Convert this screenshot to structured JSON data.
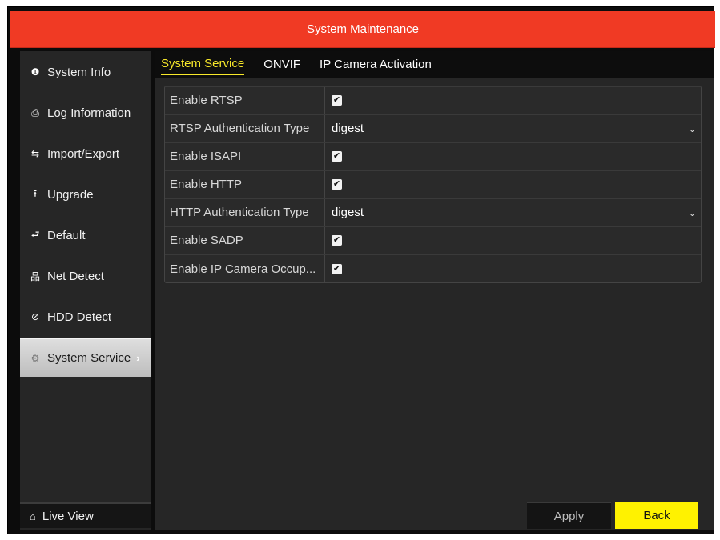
{
  "window": {
    "title": "System Maintenance"
  },
  "sidebar": {
    "items": [
      {
        "label": "System Info",
        "icon": "info-circle-icon",
        "glyph": "❶"
      },
      {
        "label": "Log Information",
        "icon": "log-icon",
        "glyph": "⎙"
      },
      {
        "label": "Import/Export",
        "icon": "import-export-icon",
        "glyph": "⇆"
      },
      {
        "label": "Upgrade",
        "icon": "upgrade-icon",
        "glyph": "⭱"
      },
      {
        "label": "Default",
        "icon": "default-icon",
        "glyph": "⮐"
      },
      {
        "label": "Net Detect",
        "icon": "network-icon",
        "glyph": "品"
      },
      {
        "label": "HDD Detect",
        "icon": "hdd-icon",
        "glyph": "⊘"
      },
      {
        "label": "System Service",
        "icon": "gear-icon",
        "glyph": "⚙",
        "active": true
      }
    ],
    "live_view": {
      "label": "Live View",
      "icon": "home-icon",
      "glyph": "⌂"
    }
  },
  "tabs": [
    {
      "label": "System Service",
      "active": true
    },
    {
      "label": "ONVIF"
    },
    {
      "label": "IP Camera Activation"
    }
  ],
  "settings": [
    {
      "label": "Enable RTSP",
      "type": "checkbox",
      "checked": true
    },
    {
      "label": "RTSP Authentication Type",
      "type": "select",
      "value": "digest"
    },
    {
      "label": "Enable ISAPI",
      "type": "checkbox",
      "checked": true
    },
    {
      "label": "Enable HTTP",
      "type": "checkbox",
      "checked": true
    },
    {
      "label": "HTTP Authentication Type",
      "type": "select",
      "value": "digest"
    },
    {
      "label": "Enable SADP",
      "type": "checkbox",
      "checked": true
    },
    {
      "label": "Enable IP Camera Occup...",
      "type": "checkbox",
      "checked": true
    }
  ],
  "buttons": {
    "apply": "Apply",
    "back": "Back"
  },
  "glyphs": {
    "check": "✔",
    "chevron": "⌄",
    "arrow_right": "›"
  },
  "colors": {
    "title_bar": "#f03a24",
    "active_tab": "#f8e82a",
    "back_button": "#fff200"
  }
}
